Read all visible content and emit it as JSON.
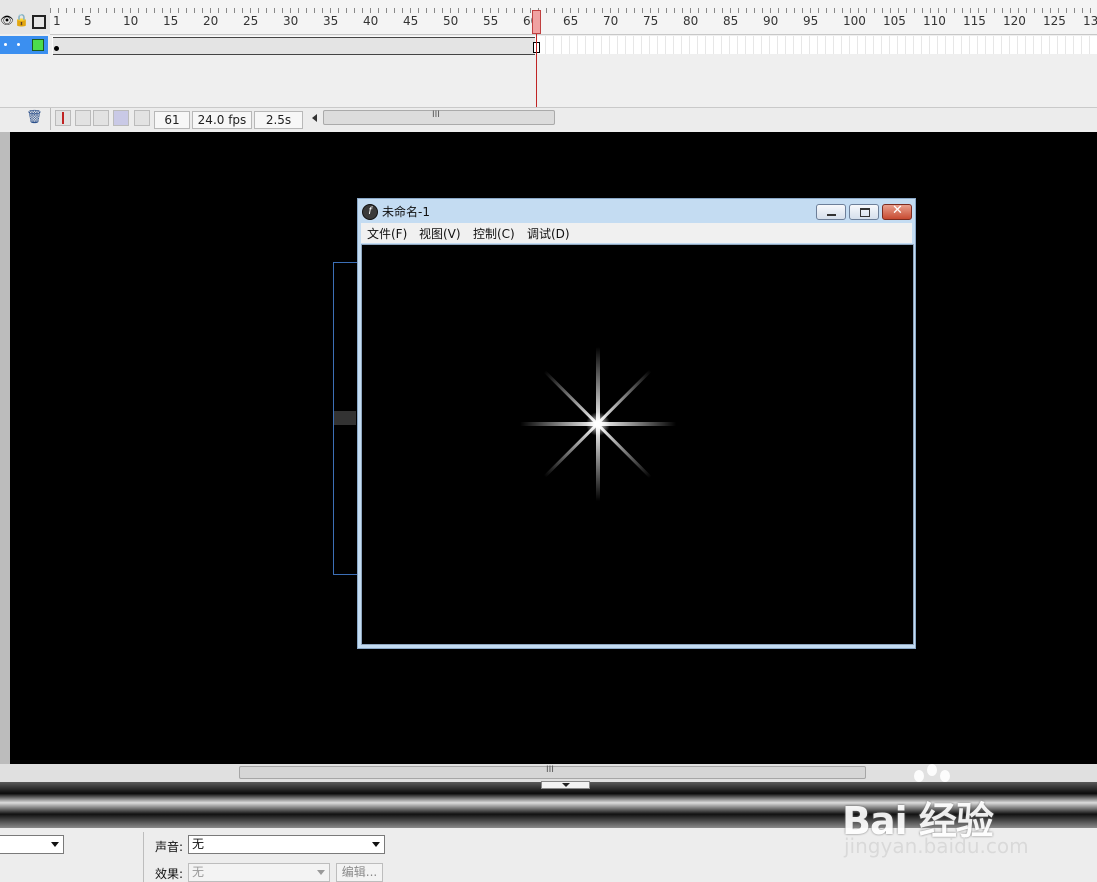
{
  "timeline": {
    "ruler_ticks": [
      "1",
      "5",
      "10",
      "15",
      "20",
      "25",
      "30",
      "35",
      "40",
      "45",
      "50",
      "55",
      "60",
      "65",
      "70",
      "75",
      "80",
      "85",
      "90",
      "95",
      "100",
      "105",
      "110",
      "115",
      "120",
      "125",
      "13"
    ],
    "current_frame": "61",
    "fps": "24.0 fps",
    "elapsed": "2.5s",
    "scroll_grip": "III"
  },
  "player": {
    "title": "未命名-1",
    "menu": [
      "文件(F)",
      "视图(V)",
      "控制(C)",
      "调试(D)"
    ]
  },
  "properties": {
    "sound_label": "声音:",
    "sound_value": "无",
    "effect_label": "效果:",
    "effect_value": "无",
    "edit_button": "编辑..."
  },
  "stage": {
    "scroll_grip": "III",
    "background_color": "#000000"
  },
  "watermark": {
    "brand": "Bai 经验",
    "url": "jingyan.baidu.com"
  },
  "colors": {
    "layer_highlight": "#3b8ff0",
    "playhead": "#c02424",
    "layer_swatch": "#4cdc4c"
  }
}
